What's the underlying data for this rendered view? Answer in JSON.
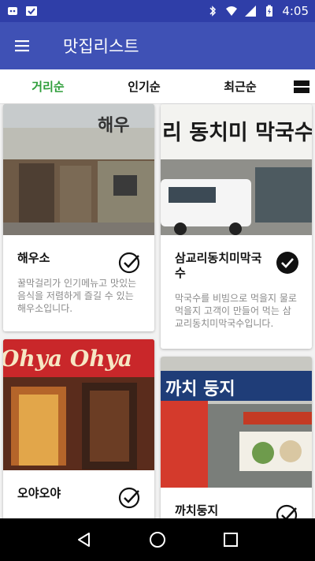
{
  "status": {
    "time": "4:05"
  },
  "app": {
    "title": "맛집리스트"
  },
  "filters": [
    "거리순",
    "인기순",
    "최근순"
  ],
  "cards": [
    {
      "title": "해우소",
      "desc": "꿀막걸리가 인기메뉴고 맛있는 음식을 저렴하게 즐길 수 있는 해우소입니다.",
      "checked": false,
      "sign": "해우"
    },
    {
      "title": "삼교리동치미막국수",
      "desc": "막국수를 비빔으로 먹을지 물로 먹을지 고객이 만들어 먹는 삼교리동치미막국수입니다.",
      "checked": true,
      "sign": "리 동치미 막국수"
    },
    {
      "title": "오야오야",
      "desc": "",
      "checked": false,
      "sign": "Ohya Ohya"
    },
    {
      "title": "까치둥지",
      "desc": "",
      "checked": false,
      "sign": "까치 둥지"
    }
  ],
  "colors": {
    "primary": "#3f51b5",
    "status": "#2f3ea8",
    "active": "#2e9e3a"
  }
}
